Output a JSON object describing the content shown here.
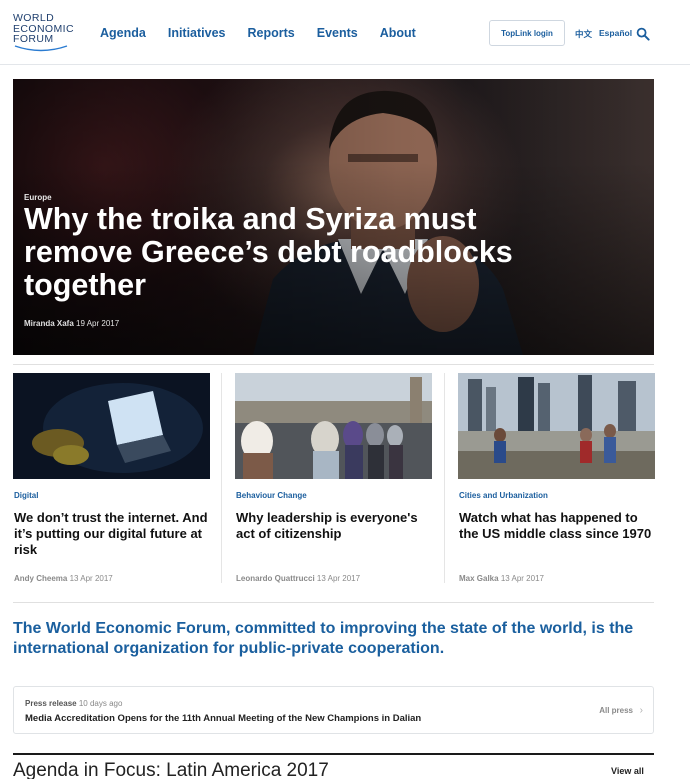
{
  "header": {
    "logo_lines": [
      "WORLD",
      "ECONOMIC",
      "FORUM"
    ],
    "nav": [
      "Agenda",
      "Initiatives",
      "Reports",
      "Events",
      "About"
    ],
    "toplink_label": "TopLink login",
    "lang_zh": "中文",
    "lang_es": "Español",
    "search_icon": "search-icon"
  },
  "hero": {
    "category": "Europe",
    "title": "Why the troika and Syriza must remove Greece’s debt roadblocks together",
    "author": "Miranda Xafa",
    "date": "19 Apr 2017"
  },
  "cards": [
    {
      "category": "Digital",
      "title": "We don’t trust the internet. And it’s putting our digital future at risk",
      "author": "Andy Cheema",
      "date": "13 Apr 2017"
    },
    {
      "category": "Behaviour Change",
      "title": "Why leadership is everyone's act of citizenship",
      "author": "Leonardo Quattrucci",
      "date": "13 Apr 2017"
    },
    {
      "category": "Cities and Urbanization",
      "title": "Watch what has happened to the US middle class since 1970",
      "author": "Max Galka",
      "date": "13 Apr 2017"
    }
  ],
  "mission": "The World Economic Forum, committed to improving the state of the world, is the international organization for public-private cooperation.",
  "press": {
    "label": "Press release",
    "age": "10 days ago",
    "title": "Media Accreditation Opens for the 11th Annual Meeting of the New Champions in Dalian",
    "all_label": "All press",
    "chevron": "›"
  },
  "focus": {
    "title": "Agenda in Focus: Latin America 2017",
    "view_all": "View all"
  },
  "colors": {
    "brand_blue": "#1b5e9e",
    "mission_blue": "#1a5f9e",
    "logo_navy": "#1f3f6e"
  }
}
